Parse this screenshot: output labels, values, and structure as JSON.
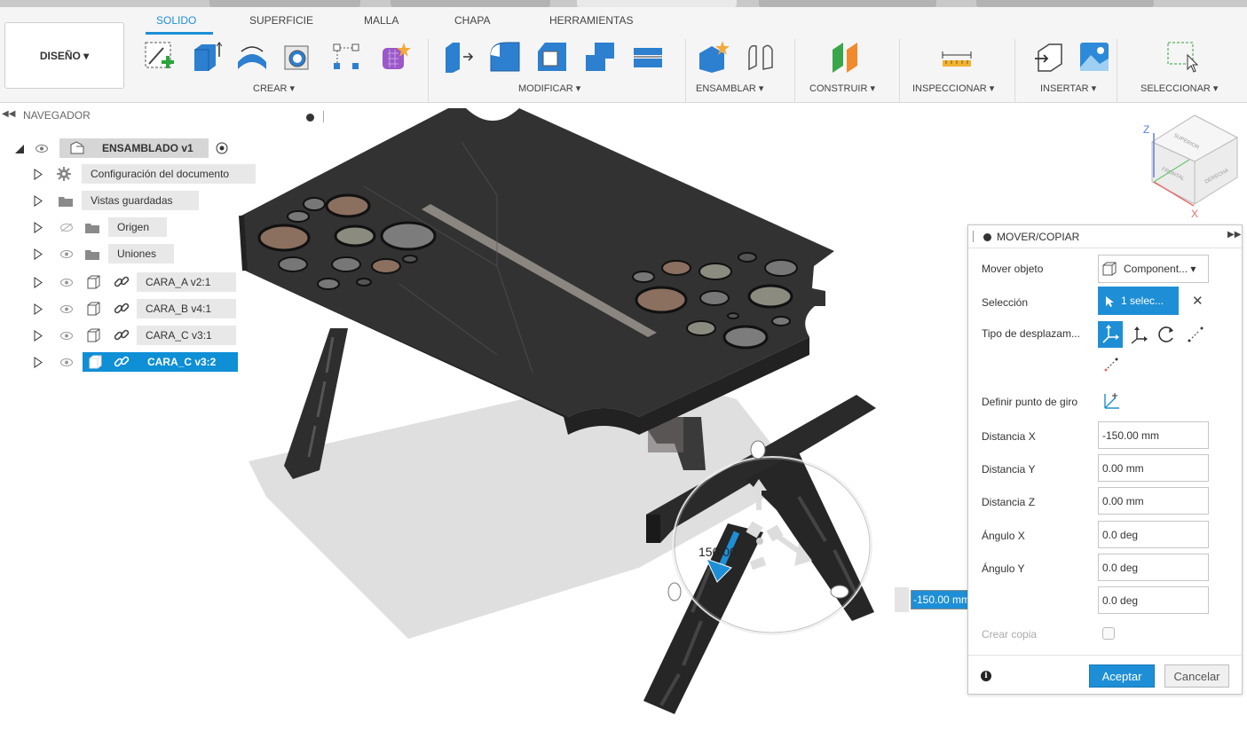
{
  "toolbar": {
    "tabs": [
      {
        "label": "SOLIDO",
        "active": true
      },
      {
        "label": "SUPERFICIE",
        "active": false
      },
      {
        "label": "MALLA",
        "active": false
      },
      {
        "label": "CHAPA",
        "active": false
      },
      {
        "label": "HERRAMIENTAS",
        "active": false
      }
    ],
    "workspace_label": "DISEÑO ▾",
    "groups": {
      "create": "CREAR ▾",
      "modify": "MODIFICAR ▾",
      "assemble": "ENSAMBLAR ▾",
      "construct": "CONSTRUIR ▾",
      "inspect": "INSPECCIONAR ▾",
      "insert": "INSERTAR ▾",
      "select": "SELECCIONAR ▾"
    },
    "accent_color": "#1e8fd6"
  },
  "navigator": {
    "title": "NAVEGADOR",
    "root_label": "ENSAMBLADO v1",
    "items": [
      {
        "label": "Configuración del documento",
        "icon": "gear-icon"
      },
      {
        "label": "Vistas guardadas",
        "icon": "folder-icon"
      },
      {
        "label": "Origen",
        "icon": "folder-icon",
        "hidden": true
      },
      {
        "label": "Uniones",
        "icon": "folder-icon"
      },
      {
        "label": "CARA_A v2:1",
        "icon": "component-icon"
      },
      {
        "label": "CARA_B v4:1",
        "icon": "component-icon"
      },
      {
        "label": "CARA_C v3:1",
        "icon": "component-icon"
      },
      {
        "label": "CARA_C v3:2",
        "icon": "component-icon",
        "selected": true
      }
    ]
  },
  "viewcube": {
    "top": "SUPERIOR",
    "front": "FRONTAL",
    "right": "DERECHA",
    "axis_z": "Z",
    "axis_x": "X"
  },
  "manipulator": {
    "dimension_label": "150.00",
    "distance_input": "-150.00 mm"
  },
  "panel": {
    "title": "MOVER/COPIAR",
    "move_object_label": "Mover objeto",
    "move_object_value": "Component... ▾",
    "selection_label": "Selección",
    "selection_value": "1 selec...",
    "move_type_label": "Tipo de desplazam...",
    "pivot_label": "Definir punto de giro",
    "fields": [
      {
        "label": "Distancia X",
        "value": "-150.00 mm"
      },
      {
        "label": "Distancia Y",
        "value": "0.00 mm"
      },
      {
        "label": "Distancia Z",
        "value": "0.00 mm"
      },
      {
        "label": "Ángulo X",
        "value": "0.0 deg"
      },
      {
        "label": "Ángulo Y",
        "value": "0.0 deg"
      }
    ],
    "angle_z_value": "0.0 deg",
    "create_copy_label": "Crear copia",
    "accept_label": "Aceptar",
    "cancel_label": "Cancelar"
  }
}
